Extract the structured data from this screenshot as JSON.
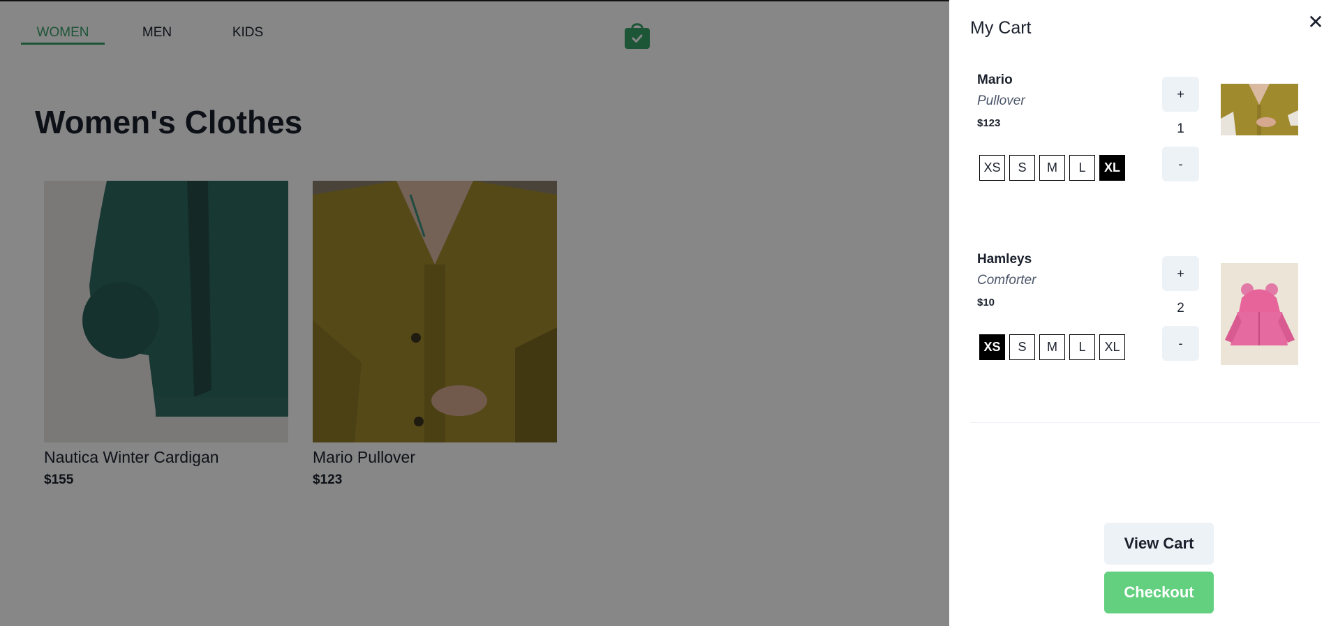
{
  "nav": {
    "items": [
      {
        "label": "WOMEN",
        "active": true
      },
      {
        "label": "MEN",
        "active": false
      },
      {
        "label": "KIDS",
        "active": false
      }
    ]
  },
  "brand_icon": "shopping-bag-check-icon",
  "page": {
    "title": "Women's Clothes",
    "products": [
      {
        "name": "Nautica Winter Cardigan",
        "price": "$155"
      },
      {
        "name": "Mario Pullover",
        "price": "$123"
      }
    ]
  },
  "cart": {
    "title": "My Cart",
    "close_icon": "close-icon",
    "items": [
      {
        "brand": "Mario",
        "name": "Pullover",
        "price": "$123",
        "sizes": [
          "XS",
          "S",
          "M",
          "L",
          "XL"
        ],
        "selected_size": "XL",
        "plus_label": "+",
        "minus_label": "-",
        "quantity": "1"
      },
      {
        "brand": "Hamleys",
        "name": "Comforter",
        "price": "$10",
        "sizes": [
          "XS",
          "S",
          "M",
          "L",
          "XL"
        ],
        "selected_size": "XS",
        "plus_label": "+",
        "minus_label": "-",
        "quantity": "2"
      }
    ],
    "view_cart_label": "View Cart",
    "checkout_label": "Checkout"
  },
  "colors": {
    "accent": "#38a169",
    "checkout": "#63d07f",
    "button_bg": "#edf2f7",
    "overlay": "rgba(0,0,0,0.47)"
  }
}
